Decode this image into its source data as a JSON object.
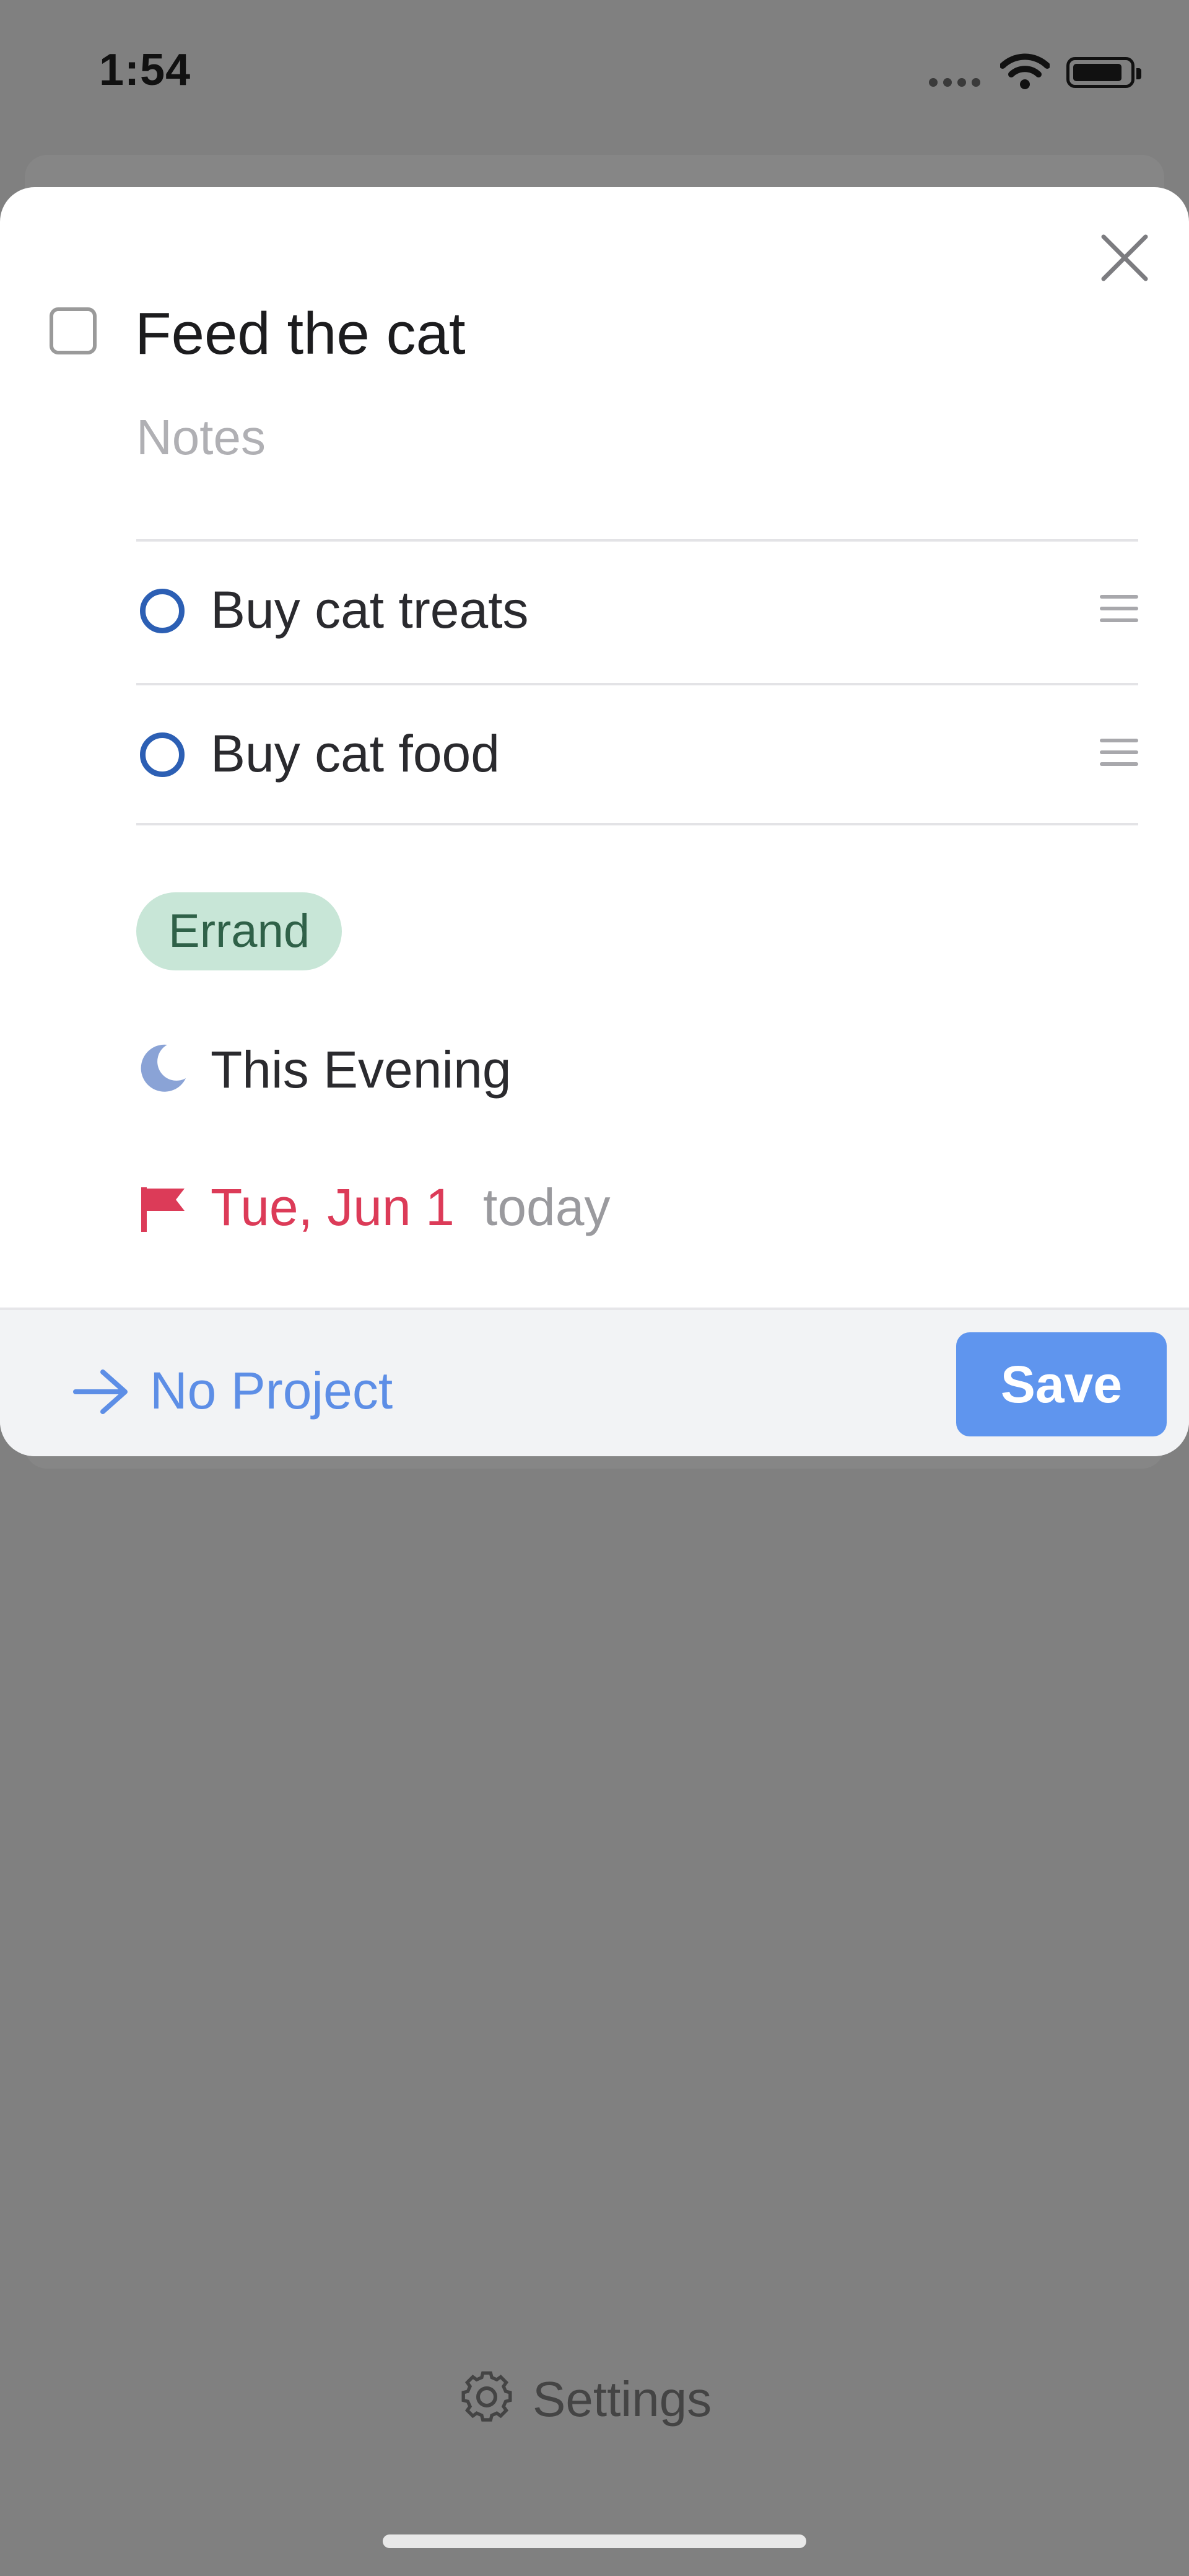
{
  "status_bar": {
    "time": "1:54"
  },
  "task": {
    "title": "Feed the cat",
    "notes_placeholder": "Notes",
    "checklist": [
      {
        "label": "Buy cat treats"
      },
      {
        "label": "Buy cat food"
      }
    ],
    "tag": "Errand",
    "when": "This Evening",
    "deadline": {
      "date": "Tue, Jun 1",
      "relative": "today"
    }
  },
  "footer": {
    "project_label": "No Project",
    "save_label": "Save"
  },
  "bottom_bar": {
    "settings_label": "Settings"
  },
  "icons": {
    "close": "close-icon",
    "checkbox": "checkbox-icon",
    "drag": "drag-handle-icon",
    "when": "moon-icon",
    "deadline": "flag-icon",
    "move": "arrow-right-icon",
    "settings": "gear-icon"
  },
  "colors": {
    "accent": "#5f95ee",
    "checklist_circle": "#2c5fb4",
    "deadline": "#dc3b58",
    "tag_bg": "#c8e6d7",
    "tag_text": "#2f6148",
    "moon": "#8aa3d6"
  }
}
